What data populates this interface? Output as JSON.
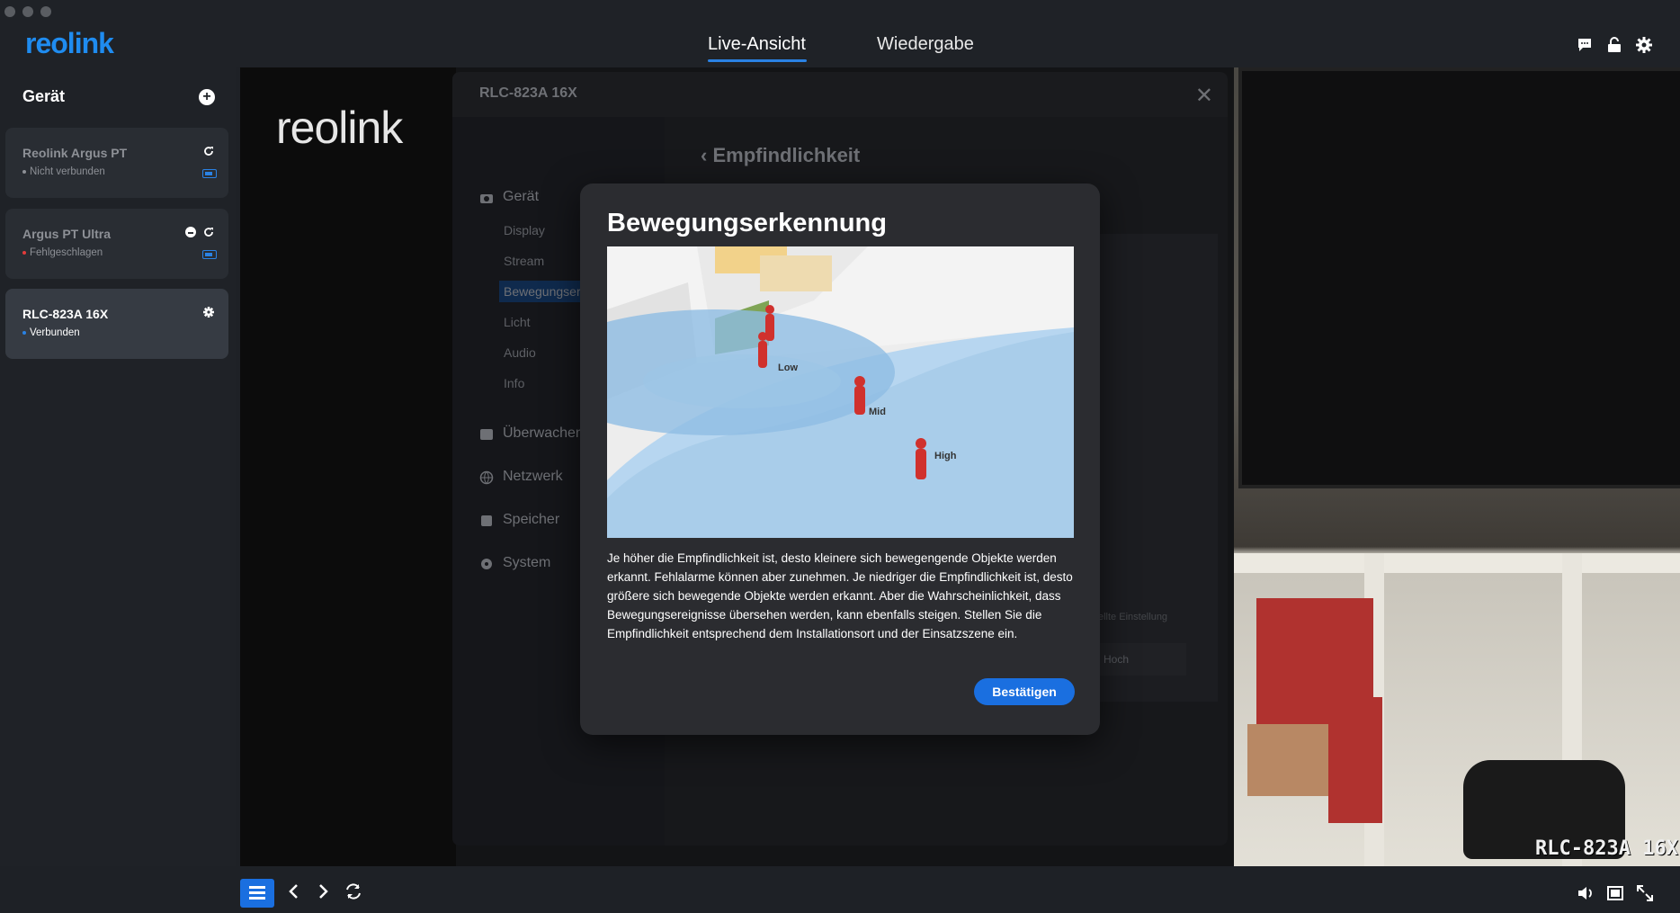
{
  "app": {
    "logo": "reolink",
    "tabs": [
      {
        "label": "Live-Ansicht",
        "active": true
      },
      {
        "label": "Wiedergabe",
        "active": false
      }
    ],
    "top_icons": [
      "chat-icon",
      "lock-icon",
      "gear-icon"
    ]
  },
  "sidebar": {
    "title": "Gerät",
    "devices": [
      {
        "name": "Reolink Argus PT",
        "status": "Nicht verbunden",
        "status_color": "#8d9096"
      },
      {
        "name": "Argus PT Ultra",
        "status": "Fehlgeschlagen",
        "status_color": "#e33b3b"
      },
      {
        "name": "RLC-823A 16X",
        "status": "Verbunden",
        "status_color": "#2a82e4"
      }
    ]
  },
  "video": {
    "logo": "reolink",
    "camera_label": "RLC-823A 16X"
  },
  "settings": {
    "title": "RLC-823A 16X",
    "back_title": "Empfindlichkeit",
    "nav": {
      "group_device": "Gerät",
      "sub_items": [
        "Display",
        "Stream",
        "Bewegungser",
        "Licht",
        "Audio",
        "Info"
      ],
      "group_monitor": "Überwachen",
      "group_network": "Netzwerk",
      "group_storage": "Speicher",
      "group_system": "System"
    },
    "ghost_text": "ellte Einstellung",
    "ghost_value": "Hoch"
  },
  "dialog": {
    "title": "Bewegungserkennung",
    "labels": {
      "low": "Low",
      "mid": "Mid",
      "high": "High"
    },
    "text": "Je höher die Empfindlichkeit ist, desto kleinere sich bewegengende Objekte werden erkannt. Fehlalarme können aber zunehmen. Je niedriger die Empfindlichkeit ist, desto größere sich bewegende Objekte werden erkannt. Aber die Wahrscheinlichkeit, dass Bewegungsereignisse übersehen werden, kann ebenfalls steigen. Stellen Sie die Empfindlichkeit entsprechend dem Installationsort und der Einsatzszene ein.",
    "confirm": "Bestätigen"
  },
  "colors": {
    "accent": "#1a6fe0",
    "background": "#1e2126"
  }
}
